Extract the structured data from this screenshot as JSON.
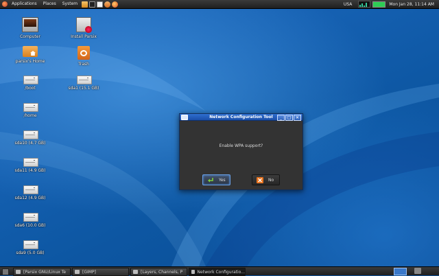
{
  "top_panel": {
    "menus": [
      "Applications",
      "Places",
      "System"
    ],
    "launcher_icons": [
      "file-manager-icon",
      "terminal-icon",
      "text-editor-icon",
      "screenshot-icon",
      "firefox-icon"
    ],
    "keyboard_layout": "USA",
    "clock": "Mon Jan 28, 11:14 AM",
    "battery_level": 1.0
  },
  "desktop_icons": [
    {
      "label": "Computer",
      "type": "computer"
    },
    {
      "label": "Install Parsix",
      "type": "installer"
    },
    {
      "label": "parsix's Home",
      "type": "home"
    },
    {
      "label": "Trash",
      "type": "trash"
    },
    {
      "label": "/boot",
      "type": "drive"
    },
    {
      "label": "sda1 (15.1 GB)",
      "type": "drive"
    },
    {
      "label": "/home",
      "type": "drive"
    },
    {
      "label": "sda10 (4.7 GB)",
      "type": "drive"
    },
    {
      "label": "sda11 (4.9 GB)",
      "type": "drive"
    },
    {
      "label": "sda12 (4.9 GB)",
      "type": "drive"
    },
    {
      "label": "sda6 (10.0 GB)",
      "type": "drive"
    },
    {
      "label": "sda9 (5.0 GB)",
      "type": "drive"
    }
  ],
  "dialog": {
    "title": "Network Configuration Tool",
    "message": "Enable WPA support?",
    "yes_label": "Yes",
    "no_label": "No",
    "win_buttons": [
      "_",
      "□",
      "✕"
    ]
  },
  "taskbar": {
    "tasks": [
      {
        "label": "[Parsix GNU/Linux Te"
      },
      {
        "label": "[GIMP]"
      },
      {
        "label": "[Layers, Channels, P"
      },
      {
        "label": "Network Configuratio..."
      }
    ]
  },
  "colors": {
    "titlebar": "#1f58b8",
    "desktop": "#0b4f98",
    "panel": "#2a2a2a",
    "focus": "#6aa0e6"
  }
}
